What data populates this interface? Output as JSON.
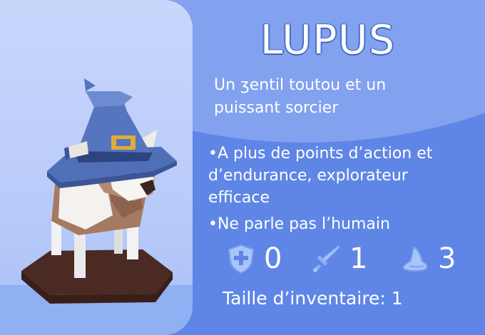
{
  "character": {
    "name": "LUPUS",
    "description": "Un ʒentil toutou et un puissant sorcier",
    "traits": [
      "•A plus de points d’action et d’endurance, explorateur efficace",
      "•Ne parle pas l’humain"
    ],
    "stats": [
      {
        "icon": "shield-plus-icon",
        "value": "0"
      },
      {
        "icon": "sword-icon",
        "value": "1"
      },
      {
        "icon": "wizard-hat-icon",
        "value": "3"
      }
    ],
    "inventory": "Taille d’inventaire: 1"
  },
  "colors": {
    "background": "#5f86e6",
    "panel": "#c8d6fb",
    "text": "#ffffff",
    "icon": "#a9c4f8"
  }
}
